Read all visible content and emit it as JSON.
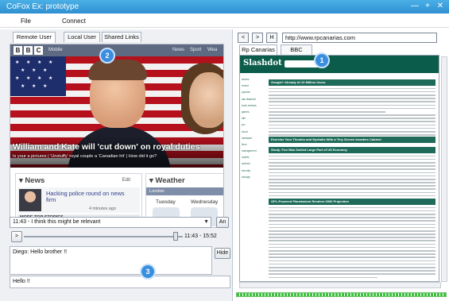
{
  "window": {
    "title": "CoFox Ex: prototype",
    "controls": [
      "—",
      "+",
      "✕"
    ]
  },
  "menu": {
    "items": [
      "File",
      "Connect"
    ]
  },
  "left": {
    "tabs": [
      {
        "label": "Remote User",
        "active": true
      },
      {
        "label": "Local User",
        "active": false
      },
      {
        "label": "Shared Links",
        "active": false
      }
    ],
    "bbc": {
      "logo": [
        "B",
        "B",
        "C"
      ],
      "mobile": "Mobile",
      "nav": [
        "News",
        "Sport",
        "Wea"
      ],
      "headline": "William and Kate will 'cut down' on royal duties",
      "subline": "Is your a pictures | 'Unstuffy' royal couple a 'Canadian hit' | How did it go?",
      "news_title": "News",
      "news_edit": "Edit",
      "news_link": "Hacking police round on news firm",
      "news_meta": "4 minutes ago",
      "more_top": "MORE TOP STORIES",
      "weather_title": "Weather",
      "weather_location": "London",
      "weather_days": [
        "Tuesday",
        "Wednesday"
      ]
    },
    "comment": {
      "selected": "11:43 - I think this might be relevant",
      "button": "An"
    },
    "player": {
      "play": ">",
      "time": "11:43 - 15:52",
      "position": 0.94
    },
    "chat": {
      "log": "Diego: Hello brother !!",
      "hide": "Hide",
      "input": "Hello !!"
    }
  },
  "right": {
    "nav": {
      "back": "<",
      "forward": ">",
      "home": "H",
      "url": "http://www.rpcanarias.com"
    },
    "tabs": [
      {
        "label": "Rp Canarias",
        "active": true
      },
      {
        "label": "BBC",
        "active": false
      }
    ],
    "site": {
      "logo": "Slashdot",
      "nav": [
        "stories",
        "recent",
        "popular",
        "ask slashdot",
        "book reviews",
        "games",
        "idle",
        "yro",
        "cloud",
        "hardware",
        "linux",
        "management",
        "mobile",
        "science",
        "security",
        "storage"
      ],
      "stories": [
        "Google+ Already At 10 Million Users",
        "Exercise Your Thumbs and Eyeballs With a Tiny Screen Invaders Cabinet",
        "Study: Fun Was Smiled Large Part of US Economy",
        "GPL-Powered Planetarium Renders 6000 Projection"
      ]
    }
  },
  "badges": [
    "1",
    "2",
    "3"
  ],
  "colors": {
    "titlebar": "#2f8fd0",
    "slashdot": "#0b5c4b",
    "badge": "#3a8ee0",
    "bbc_bar": "#5d6a82"
  }
}
